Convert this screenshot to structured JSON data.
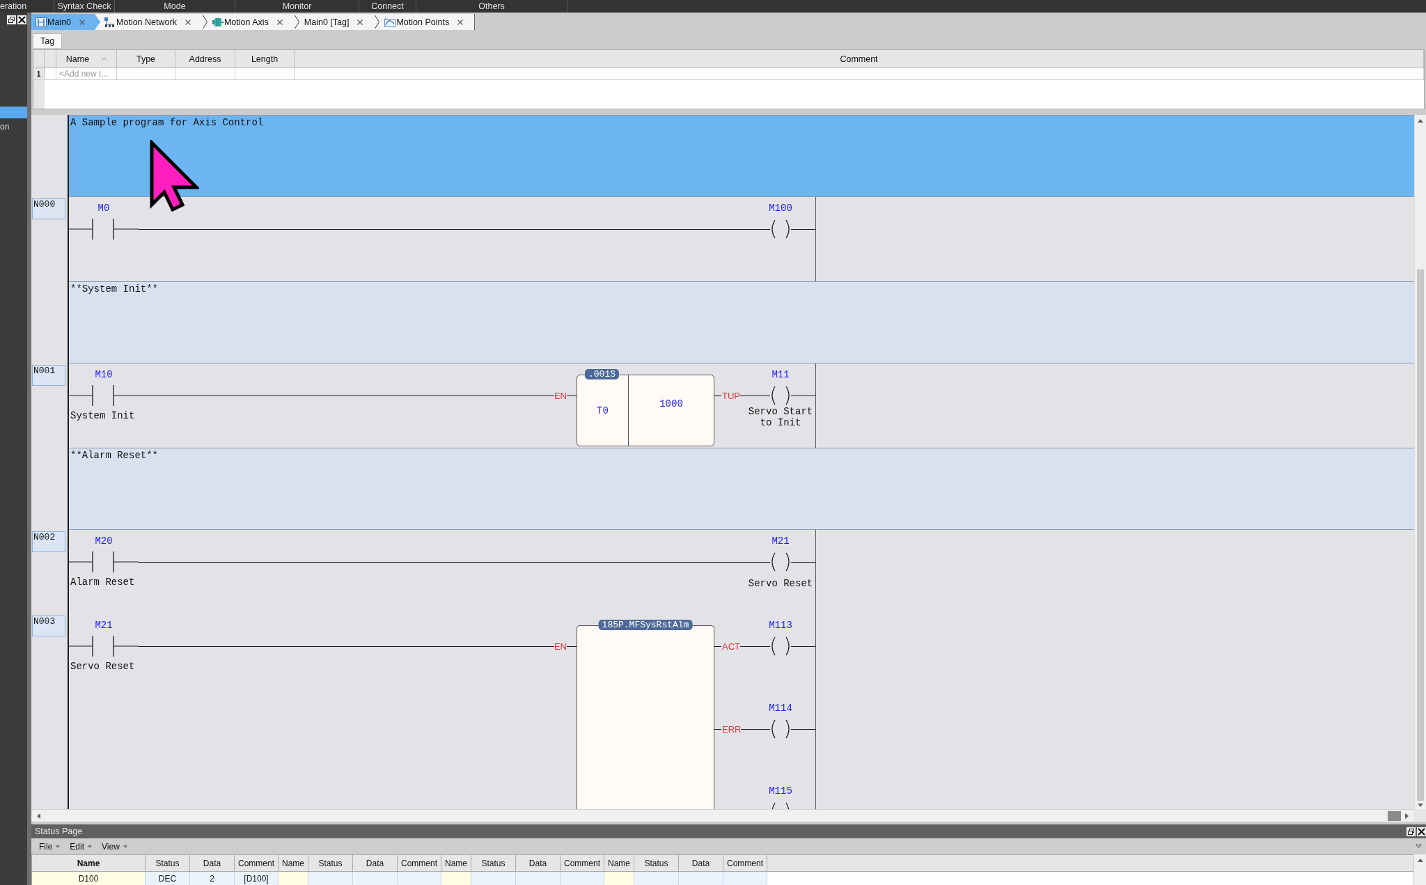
{
  "menu_bar": {
    "items": [
      "eration",
      "Syntax Check",
      "Mode",
      "Monitor",
      "Connect",
      "Others"
    ]
  },
  "sidebar": {
    "items": [
      {
        "selected": true
      },
      {
        "label": "on",
        "selected": false
      }
    ]
  },
  "tabs": [
    {
      "label": "Main0",
      "kind": "ladder",
      "selected": true
    },
    {
      "label": "Motion Network",
      "kind": "network",
      "selected": false
    },
    {
      "label": "Motion Axis",
      "kind": "axis",
      "selected": false
    },
    {
      "label": "Main0 [Tag]",
      "kind": "tag",
      "selected": false
    },
    {
      "label": "Motion Points",
      "kind": "points",
      "selected": false
    }
  ],
  "sub_tabs": [
    {
      "label": "Tag",
      "selected": true
    }
  ],
  "tag_table": {
    "columns": [
      {
        "label": "Name",
        "sorted": true
      },
      {
        "label": "Type",
        "sorted": false
      },
      {
        "label": "Address",
        "sorted": false
      },
      {
        "label": "Length",
        "sorted": false
      },
      {
        "label": "Comment",
        "sorted": false
      }
    ],
    "rows": [
      {
        "number": "1",
        "name_hint": "<Add new t..."
      }
    ]
  },
  "ladder": {
    "networks": [
      {
        "kind": "comment",
        "text": "A Sample program for Axis Control",
        "selected": true
      },
      {
        "kind": "rung",
        "label": "N000",
        "contact": {
          "address": "M0"
        },
        "outputs": [
          {
            "coil": "M100"
          }
        ]
      },
      {
        "kind": "comment",
        "text": "**System Init**",
        "selected": false
      },
      {
        "kind": "rung",
        "label": "N001",
        "contact": {
          "address": "M10",
          "comment": "System Init"
        },
        "block": {
          "kind": "timer",
          "header": ".001S",
          "input": "EN",
          "cells": [
            "T0",
            "1000"
          ]
        },
        "outputs": [
          {
            "pin": "TUP",
            "coil": "M11",
            "comment": "Servo Start to Init"
          }
        ]
      },
      {
        "kind": "comment",
        "text": "**Alarm Reset**",
        "selected": false
      },
      {
        "kind": "rung",
        "label": "N002",
        "contact": {
          "address": "M20",
          "comment": "Alarm Reset"
        },
        "outputs": [
          {
            "coil": "M21",
            "comment": "Servo Reset"
          }
        ]
      },
      {
        "kind": "rung",
        "label": "N003",
        "contact": {
          "address": "M21",
          "comment": "Servo Reset"
        },
        "block": {
          "kind": "function",
          "header": "185P.MFSysRstAlm",
          "input": "EN"
        },
        "outputs": [
          {
            "pin": "ACT",
            "coil": "M113"
          },
          {
            "pin": "ERR",
            "coil": "M114"
          },
          {
            "coil": "M115"
          }
        ]
      }
    ]
  },
  "status_page": {
    "title": "Status Page",
    "menus": [
      "File",
      "Edit",
      "View"
    ],
    "columns": [
      {
        "label": "Name",
        "bold": true
      },
      {
        "label": "Status",
        "bold": false
      },
      {
        "label": "Data",
        "bold": false
      },
      {
        "label": "Comment",
        "bold": false
      },
      {
        "label": "Name",
        "bold": false
      },
      {
        "label": "Status",
        "bold": false
      },
      {
        "label": "Data",
        "bold": false
      },
      {
        "label": "Comment",
        "bold": false
      },
      {
        "label": "Name",
        "bold": false
      },
      {
        "label": "Status",
        "bold": false
      },
      {
        "label": "Data",
        "bold": false
      },
      {
        "label": "Comment",
        "bold": false
      },
      {
        "label": "Name",
        "bold": false
      },
      {
        "label": "Status",
        "bold": false
      },
      {
        "label": "Data",
        "bold": false
      },
      {
        "label": "Comment",
        "bold": false
      }
    ],
    "rows": [
      {
        "cells": [
          "D100",
          "DEC",
          "2",
          "[D100]"
        ]
      }
    ]
  }
}
